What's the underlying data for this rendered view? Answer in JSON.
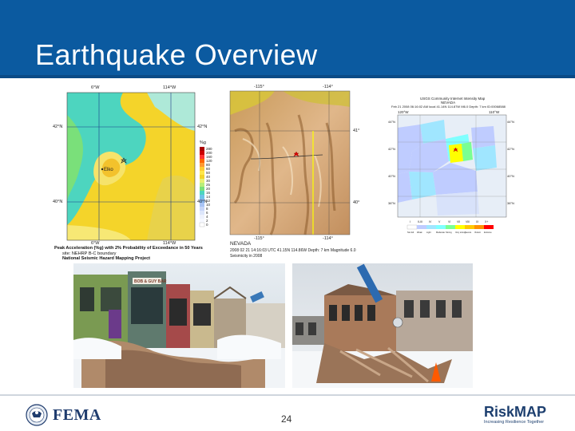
{
  "slide": {
    "title": "Earthquake Overview",
    "page_number": "24"
  },
  "map_hazard": {
    "top_left_lon": "6°W",
    "top_right_lon": "114°W",
    "bottom_left_lon": "6°W",
    "bottom_right_lon": "114°W",
    "lat_upper_left": "42°N",
    "lat_upper_right": "42°N",
    "lat_lower_left": "40°N",
    "lat_lower_right": "40°N",
    "city": "Elko",
    "legend_unit": "%g",
    "legend_values": [
      "280",
      "200",
      "160",
      "120",
      "80",
      "60",
      "50",
      "40",
      "30",
      "25",
      "20",
      "16",
      "14",
      "12",
      "10",
      "8",
      "6",
      "4",
      "2",
      "0"
    ],
    "caption_line1": "Peak Acceleration (%g) with 2% Probability of Exceedance in 50 Years",
    "caption_line2": "site: NEHRP B-C boundary",
    "caption_line3": "National Seismic Hazard Mapping Project"
  },
  "map_relief": {
    "top_lon_left": "-115°",
    "top_lon_right": "-114°",
    "lat_upper": "41°",
    "lat_lower": "40°",
    "bottom_lon_left": "-115°",
    "bottom_lon_right": "-114°",
    "region": "NEVADA",
    "caption_line1": "2008 02 21 14:16:03 UTC 41.15N 114.86W Depth: 7 km Magnitude 6.0",
    "caption_line2": "Seismicity in 2008"
  },
  "map_intensity": {
    "header_line1": "USGS Community Internet Intensity Map",
    "header_line2": "NEVADA",
    "header_line3": "Feb 21 2008 06:16:02 AM local 41.14N 114.87W M6.0 Depth: 7 km ID:00068588",
    "top_lon_left": "120°W",
    "top_lon_right": "110°W",
    "lat_labels_left": [
      "44°N",
      "42°N",
      "40°N",
      "38°N"
    ],
    "lat_labels_right": [
      "44°N",
      "42°N",
      "40°N",
      "38°N"
    ],
    "intensity_row": [
      "I",
      "II-III",
      "IV",
      "V",
      "VI",
      "VII",
      "VIII",
      "IX",
      "X+"
    ],
    "shaking_row": [
      "Not felt",
      "Weak",
      "Light",
      "Moderate",
      "Strong",
      "Very strong",
      "Severe",
      "Violent",
      "Extreme"
    ],
    "colors": [
      "#ffffff",
      "#bfccff",
      "#a0e6ff",
      "#80ffff",
      "#7aff93",
      "#ffff00",
      "#ffc800",
      "#ff9100",
      "#ff0000"
    ]
  },
  "photo_left": {
    "sign_text": "BOB & GUY BAR"
  },
  "branding": {
    "fema_label": "FEMA",
    "riskmap_label_risk": "Risk",
    "riskmap_label_map": "MAP",
    "riskmap_tagline": "Increasing Resilience Together"
  }
}
